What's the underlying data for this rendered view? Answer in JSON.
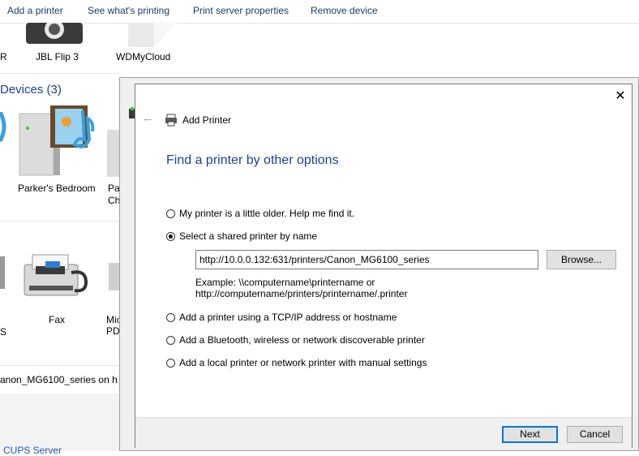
{
  "toolbar": {
    "items": [
      "Add a printer",
      "See what's printing",
      "Print server properties",
      "Remove device"
    ]
  },
  "background": {
    "top_items": [
      {
        "label": "R"
      },
      {
        "label": "JBL Flip 3"
      },
      {
        "label": "WDMyCloud"
      }
    ],
    "devices_section_title": "Devices (3)",
    "devices": [
      {
        "label": "Parker's Bedroom"
      },
      {
        "label_line1": "Par",
        "label_line2": "Ch"
      }
    ],
    "printers": [
      {
        "label": "S"
      },
      {
        "label": "Fax"
      },
      {
        "label_line1": "Mic",
        "label_line2": "PDI"
      }
    ],
    "status_text": "anon_MG6100_series on h",
    "bottom_link": "CUPS Server"
  },
  "dialog": {
    "close_symbol": "✕",
    "back_symbol": "←",
    "title": "Add Printer",
    "heading": "Find a printer by other options",
    "options": [
      {
        "label": "My printer is a little older. Help me find it.",
        "selected": false
      },
      {
        "label": "Select a shared printer by name",
        "selected": true
      },
      {
        "label": "Add a printer using a TCP/IP address or hostname",
        "selected": false
      },
      {
        "label": "Add a Bluetooth, wireless or network discoverable printer",
        "selected": false
      },
      {
        "label": "Add a local printer or network printer with manual settings",
        "selected": false
      }
    ],
    "shared_printer_url": "http://10.0.0.132:631/printers/Canon_MG6100_series",
    "browse_label": "Browse...",
    "example_line1": "Example: \\\\computername\\printername or",
    "example_line2": "http://computername/printers/printername/.printer",
    "next_label": "Next",
    "cancel_label": "Cancel"
  },
  "colors": {
    "heading_blue": "#1e3f8a",
    "default_button_border": "#0078d7",
    "dialog_footer": "#f0f0f0"
  }
}
